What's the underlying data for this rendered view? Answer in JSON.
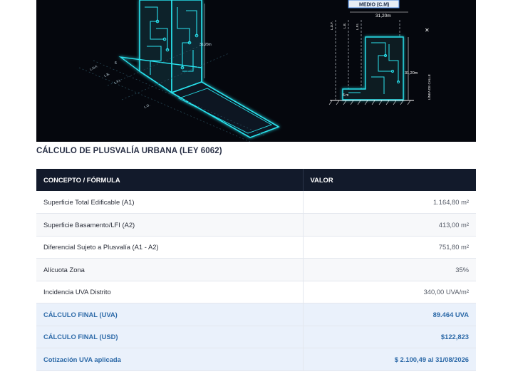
{
  "illustration": {
    "labels": {
      "medio": "MEDIO (C.M)",
      "dim_top": "31,20m",
      "dim_height_right": "31,20m",
      "dim_height_left": "31,20m",
      "dim_six_right": "6 m",
      "dim_six_left": "6",
      "ldf_right": "L.D.F.",
      "lb_right": "L.B.",
      "lfi_right": "L.F.I.",
      "ldf_left": "L.D.F.",
      "lb_left": "L.B.",
      "lfi_left": "L.F.I.",
      "lo_left": "L.O.",
      "street": "LÍNEA DE CALLE"
    },
    "colors": {
      "background": "#05070d",
      "neon": "#29e3ee",
      "diagram": "#ffffff",
      "accent": "#3b7bd8"
    }
  },
  "section": {
    "title": "CÁLCULO DE PLUSVALÍA URBANA (LEY 6062)"
  },
  "table": {
    "headers": {
      "concept": "CONCEPTO / FÓRMULA",
      "value": "VALOR"
    },
    "rows": [
      {
        "concept": "Superficie Total Edificable (A1)",
        "value": "1.164,80 m²",
        "style": "normal"
      },
      {
        "concept": "Superficie Basamento/LFI (A2)",
        "value": "413,00 m²",
        "style": "alt"
      },
      {
        "concept": "Diferencial Sujeto a Plusvalía (A1 - A2)",
        "value": "751,80 m²",
        "style": "normal"
      },
      {
        "concept": "Alícuota Zona",
        "value": "35%",
        "style": "alt"
      },
      {
        "concept": "Incidencia UVA Distrito",
        "value": "340,00 UVA/m²",
        "style": "normal"
      },
      {
        "concept": "CÁLCULO FINAL (UVA)",
        "value": "89.464 UVA",
        "style": "hl"
      },
      {
        "concept": "CÁLCULO FINAL (USD)",
        "value": "$122,823",
        "style": "hl"
      },
      {
        "concept": "Cotización UVA aplicada",
        "value": "$ 2.100,49 al 31/08/2026",
        "style": "hl"
      }
    ],
    "colors": {
      "header_bg": "#121a2b",
      "highlight_text": "#2d6aa8",
      "highlight_bg": "#eaf1fb"
    }
  }
}
